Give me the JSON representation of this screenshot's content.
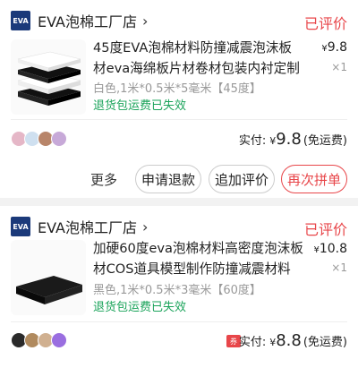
{
  "orders": [
    {
      "store_logo": "EVA",
      "store_name": "EVA泡棉工厂店",
      "status": "已评价",
      "title": "45度EVA泡棉材料防撞减震泡沫板材eva海绵板片材卷材包装内衬定制",
      "price_symbol": "¥",
      "price": "9.8",
      "qty": "×1",
      "spec": "白色,1米*0.5米*5毫米【45度】",
      "refund": "退货包运费已失效",
      "pay_label": "实付:",
      "pay_currency": "¥",
      "pay_amount": "9.8",
      "pay_note": "(免运费)",
      "more": "更多",
      "buttons": [
        "申请退款",
        "追加评价",
        "再次拼单"
      ]
    },
    {
      "store_logo": "EVA",
      "store_name": "EVA泡棉工厂店",
      "status": "已评价",
      "title": "加硬60度eva泡棉材料高密度泡沫板材COS道具模型制作防撞减震材料",
      "price_symbol": "¥",
      "price": "10.8",
      "qty": "×1",
      "spec": "黑色,1米*0.5米*3毫米【60度】",
      "refund": "退货包运费已失效",
      "coupon": "券",
      "pay_label": "实付:",
      "pay_currency": "¥",
      "pay_amount": "8.8",
      "pay_note": "(免运费)"
    }
  ],
  "icons": {
    "chevron": "chevron-right-icon"
  },
  "colors": {
    "accent_red": "#e8464a",
    "refund_green": "#1aa35a",
    "store_logo_bg": "#1b3a7a"
  }
}
